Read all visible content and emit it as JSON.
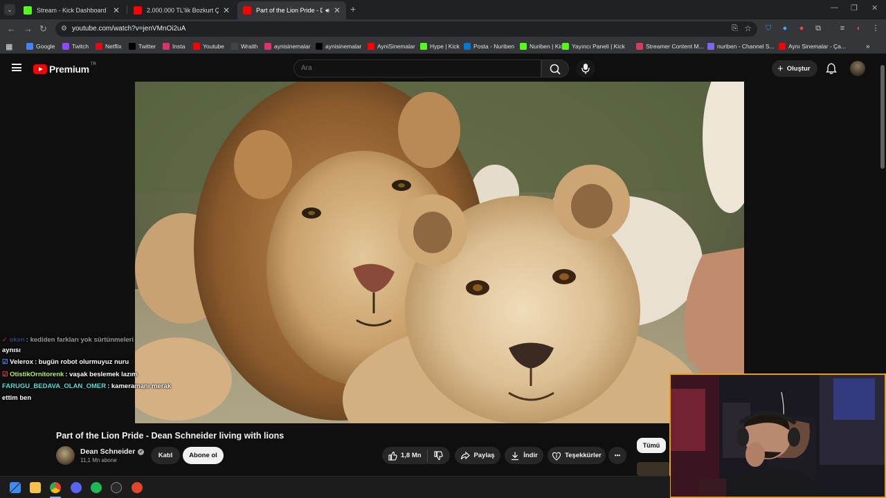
{
  "browser": {
    "tabs": [
      {
        "title": "Stream - Kick Dashboard",
        "favicon_color": "#53fc18",
        "active": false
      },
      {
        "title": "2.000.000 TL'lik Bozkurt Çiftliği",
        "favicon_color": "#ff0000",
        "active": false
      },
      {
        "title": "Part of the Lion Pride - Dea",
        "favicon_color": "#ff0000",
        "active": true
      }
    ],
    "new_tab": "+",
    "url": "youtube.com/watch?v=jenVMnOi2uA",
    "bookmarks": [
      {
        "label": "Google",
        "icon": "google-icon",
        "color": "#4285f4"
      },
      {
        "label": "Twitch",
        "icon": "twitch-icon",
        "color": "#9146ff"
      },
      {
        "label": "Netflix",
        "icon": "netflix-icon",
        "color": "#e50914"
      },
      {
        "label": "Twitter",
        "icon": "x-icon",
        "color": "#000000"
      },
      {
        "label": "Insta",
        "icon": "instagram-icon",
        "color": "#e1306c"
      },
      {
        "label": "Youtube",
        "icon": "youtube-icon",
        "color": "#ff0000"
      },
      {
        "label": "Wraith",
        "icon": "wraith-icon",
        "color": "#444444"
      },
      {
        "label": "aynisinemalar",
        "icon": "instagram-icon",
        "color": "#e1306c"
      },
      {
        "label": "aynisinemalar",
        "icon": "x-icon",
        "color": "#000000"
      },
      {
        "label": "AyniSinemalar",
        "icon": "youtube-icon",
        "color": "#ff0000"
      },
      {
        "label": "Hype | Kick",
        "icon": "kick-icon",
        "color": "#53fc18"
      },
      {
        "label": "Posta - Nuriben",
        "icon": "outlook-icon",
        "color": "#0078d4"
      },
      {
        "label": "Nuriben | Kick",
        "icon": "kick-icon",
        "color": "#53fc18"
      },
      {
        "label": "Yayıncı Paneli | Kick",
        "icon": "kick-icon",
        "color": "#53fc18"
      },
      {
        "label": "Streamer Content M...",
        "icon": "streamer-icon",
        "color": "#d63a5e"
      },
      {
        "label": "nuriben - Channel S...",
        "icon": "channel-icon",
        "color": "#7b68ee"
      },
      {
        "label": "Aynı Sinemalar - Ça...",
        "icon": "youtube-icon",
        "color": "#ff0000"
      }
    ]
  },
  "youtube": {
    "logo_text": "Premium",
    "region": "TR",
    "search_placeholder": "Ara",
    "create_label": "Oluştur",
    "video": {
      "title": "Part of the Lion Pride - Dean Schneider living with lions",
      "channel": "Dean Schneider",
      "subscribers": "11,1 Mn abone",
      "join_label": "Katıl",
      "subscribe_label": "Abone ol",
      "likes": "1,8 Mn",
      "share_label": "Paylaş",
      "download_label": "İndir",
      "thanks_label": "Teşekkürler",
      "more_label": "•••"
    },
    "filter_chip": "Tümü"
  },
  "chat": [
    {
      "user": "oken",
      "message": ": kediden farkları yok sürtünmeleri",
      "user_color": "#5b6bd8",
      "faded": true
    },
    {
      "user": "",
      "message": "aynısı",
      "user_color": "#ffffff",
      "faded": false
    },
    {
      "user": "Velerox",
      "message": ": bugün robot olurmuyuz nuru",
      "user_color": "#ffffff",
      "faded": false
    },
    {
      "user": "OtistikOrnitorenk",
      "message": ": vaşak beslemek lazım",
      "user_color": "#b3f55b",
      "faded": false
    },
    {
      "user": "FARUGU_BEDAVA_OLAN_OMER",
      "message": ": kameramanı merak",
      "user_color": "#4fe3d6",
      "faded": false
    },
    {
      "user": "",
      "message": "ettim ben",
      "user_color": "#ffffff",
      "faded": false
    }
  ],
  "colors": {
    "yt_bg": "#0f0f0f",
    "yt_red": "#ff0000",
    "webcam_border": "#e8a10f",
    "kick_green": "#53fc18"
  }
}
